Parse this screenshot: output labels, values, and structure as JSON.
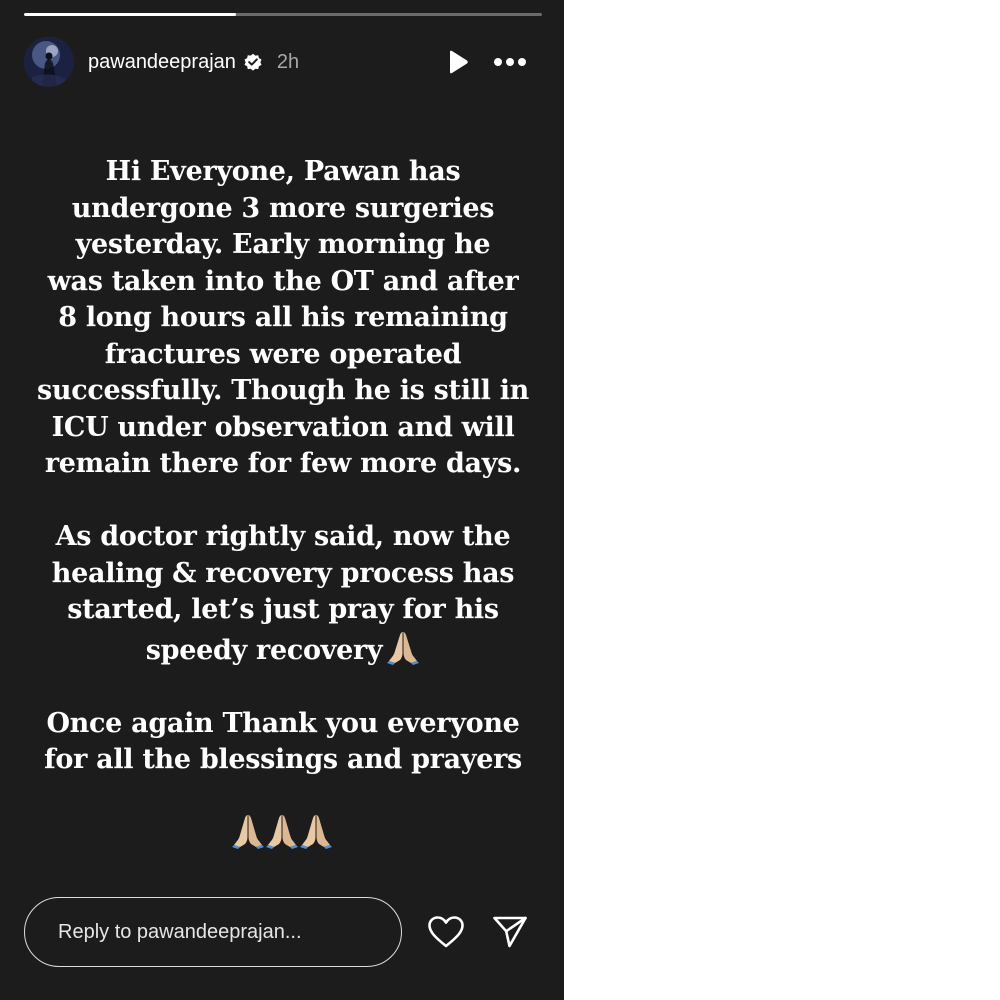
{
  "story": {
    "progress": 0.41,
    "header": {
      "username": "pawandeeprajan",
      "verified": true,
      "time_ago": "2h",
      "avatar_icon": "avatar-photo",
      "play_icon": "play-icon",
      "more_icon": "more-options-icon"
    },
    "text": {
      "paragraph_1": [
        "Hi Everyone, Pawan has",
        "undergone 3 more surgeries",
        "yesterday. Early morning he",
        "was taken into the OT and after",
        "8 long hours all his remaining",
        "fractures were operated",
        "successfully. Though he is still in",
        "ICU under observation and will",
        "remain there for few more days."
      ],
      "paragraph_2": [
        "As doctor rightly said, now the",
        "healing & recovery process has",
        "started, let’s just pray for his",
        "speedy recovery"
      ],
      "paragraph_3": [
        "Once again Thank you everyone",
        "for all the blessings and prayers"
      ],
      "emoji": "folded-hands",
      "emoji_row_count": 3
    },
    "footer": {
      "reply_placeholder": "Reply to pawandeeprajan...",
      "like_icon": "heart-icon",
      "share_icon": "send-icon"
    },
    "colors": {
      "background": "#1c1c1c",
      "text": "#ffffff",
      "muted": "#a8a8a8"
    }
  }
}
